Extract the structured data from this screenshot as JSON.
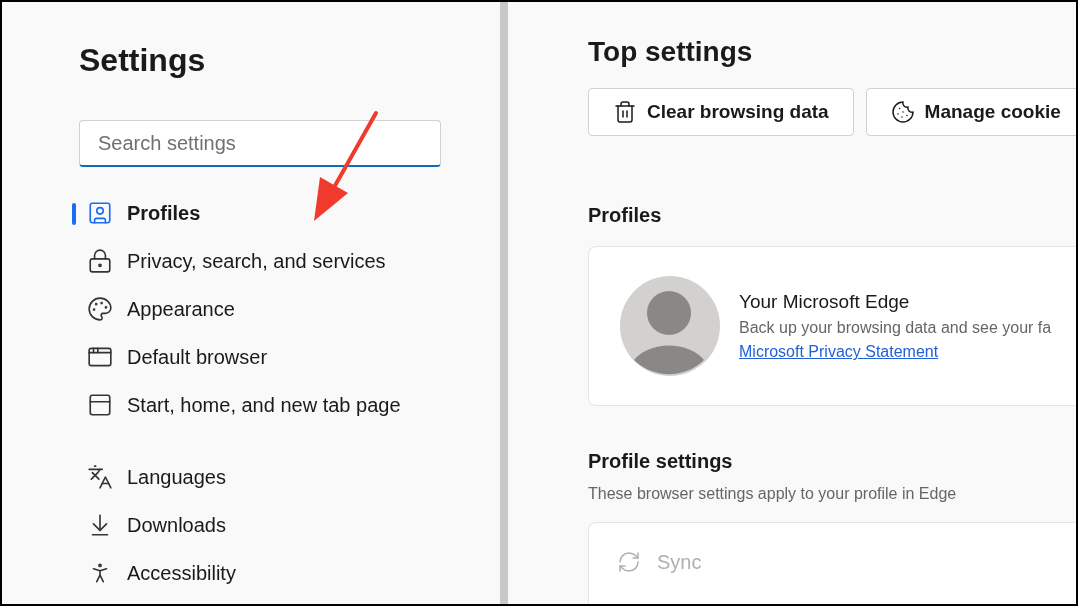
{
  "sidebar": {
    "title": "Settings",
    "search": {
      "placeholder": "Search settings"
    },
    "groups": [
      {
        "items": [
          {
            "label": "Profiles",
            "selected": true
          },
          {
            "label": "Privacy, search, and services",
            "selected": false
          },
          {
            "label": "Appearance",
            "selected": false
          },
          {
            "label": "Default browser",
            "selected": false
          },
          {
            "label": "Start, home, and new tab page",
            "selected": false
          }
        ]
      },
      {
        "items": [
          {
            "label": "Languages",
            "selected": false
          },
          {
            "label": "Downloads",
            "selected": false
          },
          {
            "label": "Accessibility",
            "selected": false
          }
        ]
      }
    ]
  },
  "main": {
    "title": "Top settings",
    "top_buttons": [
      {
        "label": "Clear browsing data"
      },
      {
        "label": "Manage cookie"
      }
    ],
    "profiles": {
      "heading": "Profiles",
      "card": {
        "name": "Your Microsoft Edge",
        "description": "Back up your browsing data and see your fa",
        "link": "Microsoft Privacy Statement"
      }
    },
    "profile_settings": {
      "heading": "Profile settings",
      "subtitle": "These browser settings apply to your profile in Edge",
      "rows": [
        {
          "label": "Sync",
          "disabled": true
        }
      ]
    }
  }
}
